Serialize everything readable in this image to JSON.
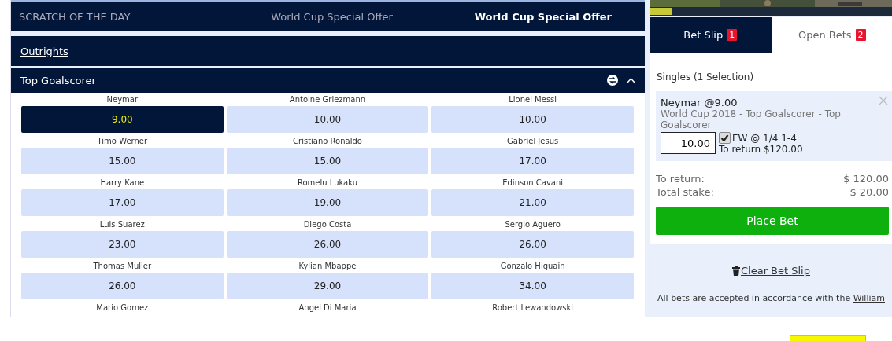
{
  "promo_tabs": [
    {
      "label": "SCRATCH OF THE DAY",
      "selected": false
    },
    {
      "label": "World Cup Special Offer",
      "selected": false
    },
    {
      "label": "World Cup Special Offer",
      "selected": true
    }
  ],
  "outrights_link": "Outrights",
  "market": {
    "title": "Top Goalscorer",
    "expanded": true,
    "selections": [
      {
        "name": "Neymar",
        "odds": "9.00",
        "selected": true
      },
      {
        "name": "Antoine Griezmann",
        "odds": "10.00",
        "selected": false
      },
      {
        "name": "Lionel Messi",
        "odds": "10.00",
        "selected": false
      },
      {
        "name": "Timo Werner",
        "odds": "15.00",
        "selected": false
      },
      {
        "name": "Cristiano Ronaldo",
        "odds": "15.00",
        "selected": false
      },
      {
        "name": "Gabriel Jesus",
        "odds": "17.00",
        "selected": false
      },
      {
        "name": "Harry Kane",
        "odds": "17.00",
        "selected": false
      },
      {
        "name": "Romelu Lukaku",
        "odds": "19.00",
        "selected": false
      },
      {
        "name": "Edinson Cavani",
        "odds": "21.00",
        "selected": false
      },
      {
        "name": "Luis Suarez",
        "odds": "23.00",
        "selected": false
      },
      {
        "name": "Diego Costa",
        "odds": "26.00",
        "selected": false
      },
      {
        "name": "Sergio Aguero",
        "odds": "26.00",
        "selected": false
      },
      {
        "name": "Thomas Muller",
        "odds": "26.00",
        "selected": false
      },
      {
        "name": "Kylian Mbappe",
        "odds": "29.00",
        "selected": false
      },
      {
        "name": "Gonzalo Higuain",
        "odds": "34.00",
        "selected": false
      },
      {
        "name": "Mario Gomez"
      },
      {
        "name": "Angel Di Maria"
      },
      {
        "name": "Robert Lewandowski"
      }
    ]
  },
  "betslip": {
    "tabs": [
      {
        "label": "Bet Slip",
        "count": "1",
        "selected": true
      },
      {
        "label": "Open Bets",
        "count": "2",
        "selected": false
      }
    ],
    "heading": "Singles (1 Selection)",
    "bet": {
      "title": "Neymar @9.00",
      "market": "World Cup 2018 - Top Goalscorer - Top Goalscorer",
      "stake": "10.00",
      "each_way": {
        "label": "EW @ 1/4 1-4",
        "checked": true
      },
      "to_return": "To return $120.00"
    },
    "totals": [
      {
        "label": "To return:",
        "value": "$ 120.00"
      },
      {
        "label": "Total stake:",
        "value": "$ 20.00"
      }
    ],
    "place_button": "Place Bet",
    "clear_link": "Clear Bet Slip",
    "terms": {
      "text": "All bets are accepted in accordance with the",
      "link": "William"
    }
  }
}
